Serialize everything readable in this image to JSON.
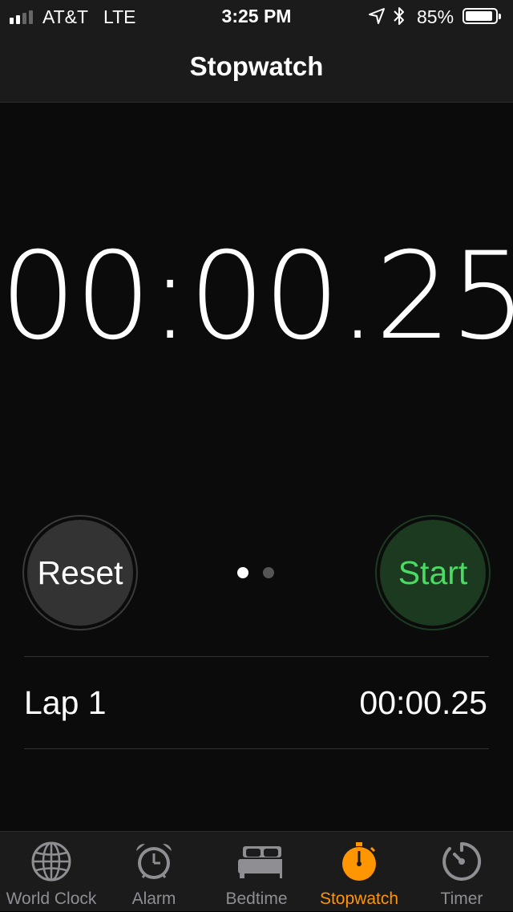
{
  "status_bar": {
    "carrier": "AT&T",
    "network": "LTE",
    "time": "3:25 PM",
    "battery_percent": "85%",
    "battery_level": 0.85,
    "signal_bars_filled": 2,
    "signal_bars_total": 4
  },
  "nav": {
    "title": "Stopwatch"
  },
  "stopwatch": {
    "time": "00:00.25"
  },
  "controls": {
    "reset_label": "Reset",
    "start_label": "Start",
    "page_count": 2,
    "current_page": 1
  },
  "laps": [
    {
      "label": "Lap 1",
      "time": "00:00.25"
    }
  ],
  "tabs": [
    {
      "label": "World Clock",
      "icon": "globe-icon",
      "active": false
    },
    {
      "label": "Alarm",
      "icon": "alarm-clock-icon",
      "active": false
    },
    {
      "label": "Bedtime",
      "icon": "bed-icon",
      "active": false
    },
    {
      "label": "Stopwatch",
      "icon": "stopwatch-icon",
      "active": true
    },
    {
      "label": "Timer",
      "icon": "timer-icon",
      "active": false
    }
  ],
  "colors": {
    "accent": "#ff9500",
    "start_green": "#4cd964",
    "background": "#0b0b0b"
  }
}
